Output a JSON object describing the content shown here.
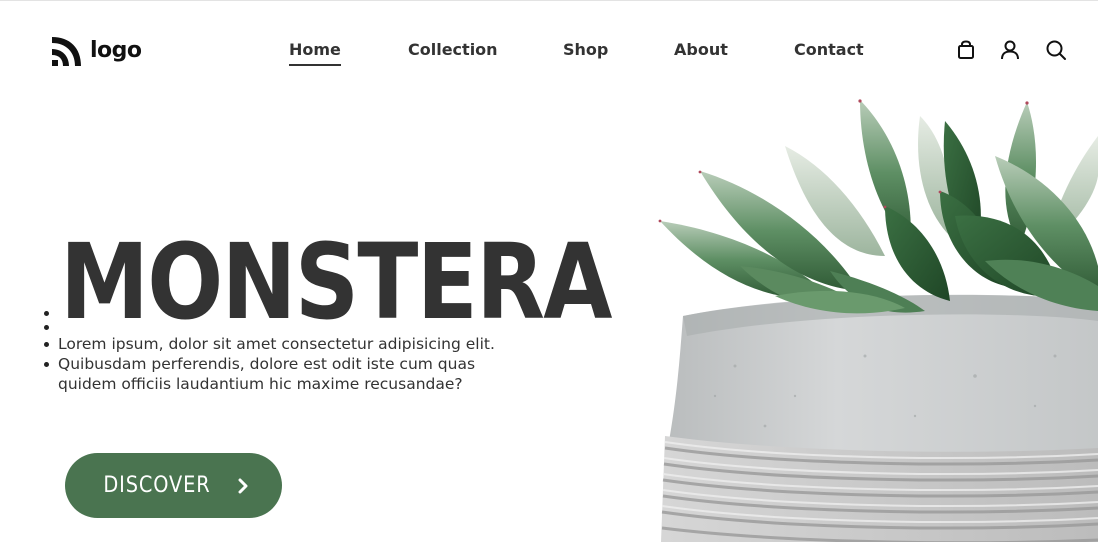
{
  "brand": {
    "logo_text": "logo",
    "logo_icon": "logo-waves-icon"
  },
  "nav": {
    "items": [
      {
        "label": "Home",
        "active": true
      },
      {
        "label": "Collection",
        "active": false
      },
      {
        "label": "Shop",
        "active": false
      },
      {
        "label": "About",
        "active": false
      },
      {
        "label": "Contact",
        "active": false
      }
    ]
  },
  "header_icons": {
    "bag": "shopping-bag-icon",
    "user": "user-icon",
    "search": "search-icon"
  },
  "hero": {
    "title": "MONSTERA",
    "bullets": [
      "",
      "",
      "Lorem ipsum, dolor sit amet consectetur adipisicing elit.",
      "Quibusdam perferendis, dolore est odit iste cum quas quidem officiis laudantium hic maxime recusandae?"
    ],
    "cta_label": "DISCOVER",
    "cta_icon": "chevron-right-icon",
    "image_subject": "succulent in concrete pot"
  },
  "colors": {
    "accent": "#4a7450",
    "text": "#333333",
    "background": "#ffffff"
  }
}
